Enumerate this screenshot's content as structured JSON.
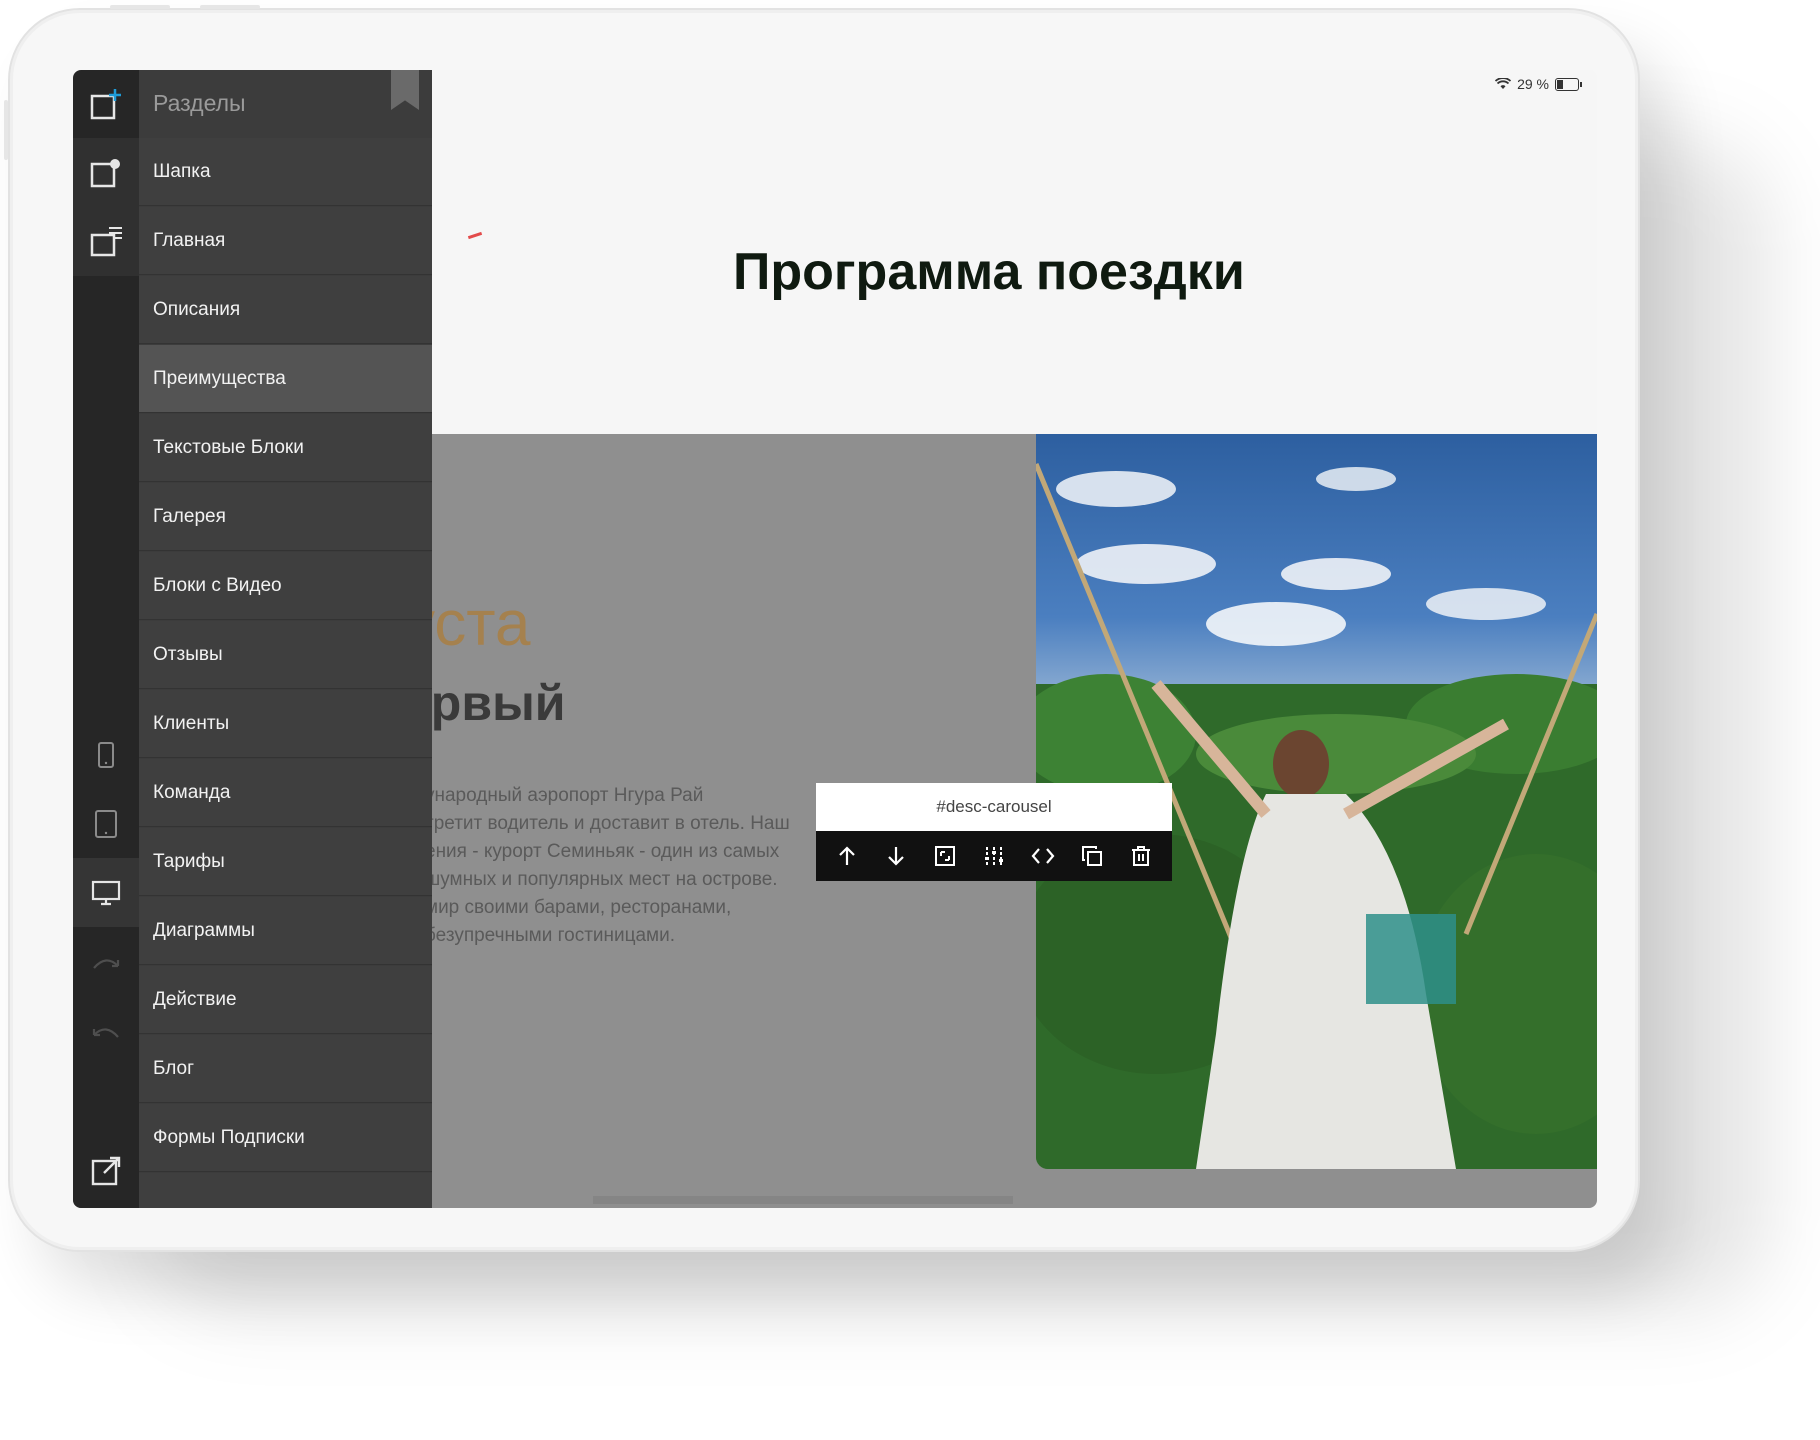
{
  "status_bar": {
    "battery": "29 %"
  },
  "page": {
    "title": "Программа поездки",
    "date_fragment": "уста",
    "day_fragment": "ервый",
    "description_lines": [
      "ународный аэропорт Нгура Рай",
      "третит водитель и доставит в отель. Наш",
      "ения - курорт Семиньяк - один из самых",
      "шумных и популярных мест на острове.",
      "мир своими барами, ресторанами,",
      "безупречными гостиницами."
    ]
  },
  "panel": {
    "title": "Разделы",
    "items": [
      "Шапка",
      "Главная",
      "Описания",
      "Преимущества",
      "Текстовые Блоки",
      "Галерея",
      "Блоки с Видео",
      "Отзывы",
      "Клиенты",
      "Команда",
      "Тарифы",
      "Диаграммы",
      "Действие",
      "Блог",
      "Формы Подписки"
    ],
    "selected": "Преимущества"
  },
  "toolbar": {
    "label": "#desc-carousel",
    "buttons": [
      "move-up",
      "move-down",
      "resize",
      "settings",
      "code",
      "duplicate",
      "delete"
    ]
  },
  "rail_icons": [
    "add-section-icon",
    "header-section-icon",
    "content-section-icon",
    "phone-icon",
    "tablet-icon",
    "desktop-icon",
    "redo-icon",
    "undo-icon",
    "open-external-icon"
  ],
  "colors": {
    "accent": "#1e9bd7",
    "panel_bg": "#3c3c3c",
    "rail_bg": "#262626",
    "date_color": "#a5814e"
  }
}
